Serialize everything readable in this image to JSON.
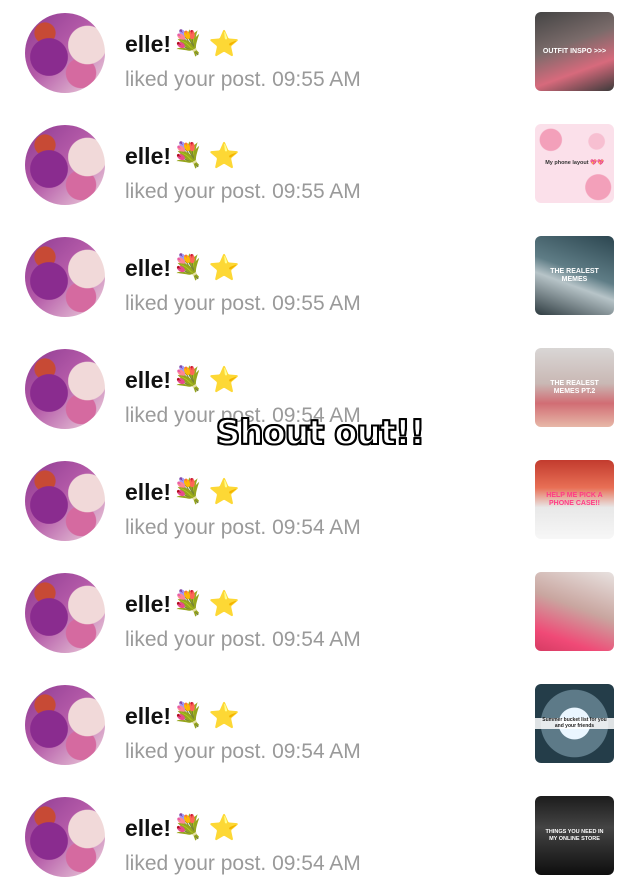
{
  "notifications": [
    {
      "name": "elle!",
      "emoji": "💐",
      "star": "⭐",
      "message": "liked your post. 09:55 AM",
      "thumb_text": "OUTFIT INSPO >>>"
    },
    {
      "name": "elle!",
      "emoji": "💐",
      "star": "⭐",
      "message": "liked your post. 09:55 AM",
      "thumb_text": "My phone layout 💖💖"
    },
    {
      "name": "elle!",
      "emoji": "💐",
      "star": "⭐",
      "message": "liked your post. 09:55 AM",
      "thumb_text": "THE REALEST MEMES"
    },
    {
      "name": "elle!",
      "emoji": "💐",
      "star": "⭐",
      "message": "liked your post. 09:54 AM",
      "thumb_text": "THE REALEST MEMES PT.2"
    },
    {
      "name": "elle!",
      "emoji": "💐",
      "star": "⭐",
      "message": "liked your post. 09:54 AM",
      "thumb_text": "HELP ME PICK A PHONE CASE!!"
    },
    {
      "name": "elle!",
      "emoji": "💐",
      "star": "⭐",
      "message": "liked your post. 09:54 AM",
      "thumb_text": ""
    },
    {
      "name": "elle!",
      "emoji": "💐",
      "star": "⭐",
      "message": "liked your post. 09:54 AM",
      "thumb_text": "Summer bucket list for you and your friends"
    },
    {
      "name": "elle!",
      "emoji": "💐",
      "star": "⭐",
      "message": "liked your post. 09:54 AM",
      "thumb_text": "THINGS YOU NEED IN MY ONLINE STORE"
    }
  ],
  "overlay": {
    "shout_text": "Shout out!!"
  }
}
